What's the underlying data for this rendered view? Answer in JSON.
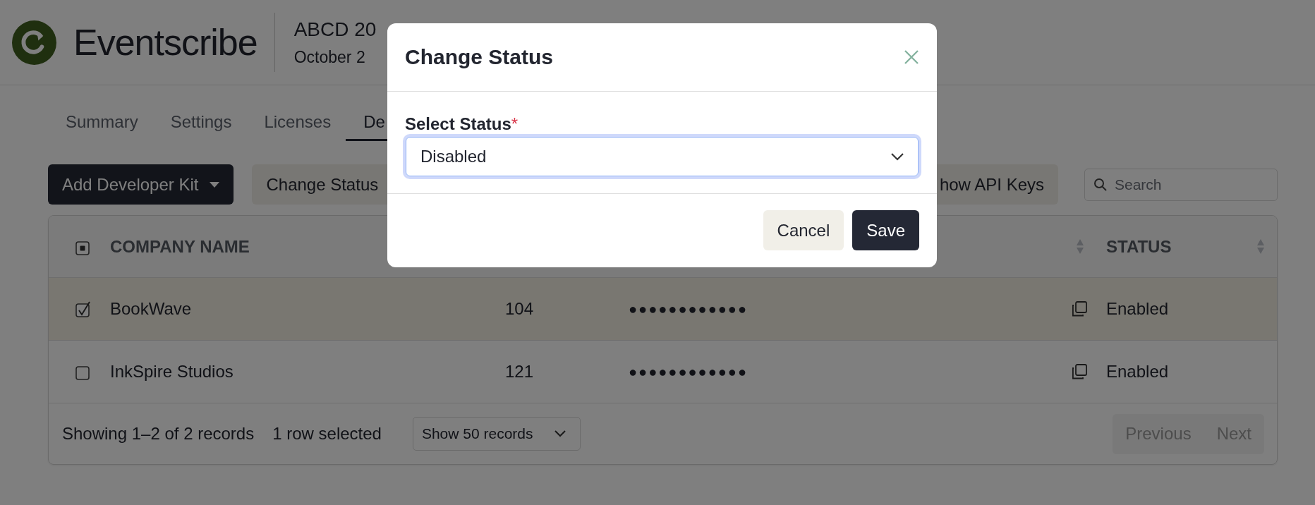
{
  "header": {
    "logo_text": "Eventscribe",
    "event_title": "ABCD 20",
    "event_date": "October 2"
  },
  "tabs": [
    {
      "label": "Summary",
      "selected": false
    },
    {
      "label": "Settings",
      "selected": false
    },
    {
      "label": "Licenses",
      "selected": false
    },
    {
      "label": "De",
      "selected": true
    }
  ],
  "toolbar": {
    "buttons": [
      {
        "label": "Add Developer Kit",
        "kind": "primary-dropdown"
      },
      {
        "label": "Change Status",
        "kind": "secondary"
      }
    ],
    "right_buttons": [
      {
        "label": "how API Keys",
        "kind": "secondary"
      }
    ],
    "search": {
      "placeholder": "Search"
    }
  },
  "table": {
    "select_all": {
      "indeterminate": true
    },
    "columns": [
      {
        "label": "COMPANY NAME",
        "sortable": false
      },
      {
        "sortable": true
      },
      {
        "label": "STATUS",
        "sortable": true
      }
    ],
    "rows": [
      {
        "selected": true,
        "company": "BookWave",
        "number": "104",
        "key": "●●●●●●●●●●●●",
        "status": "Enabled"
      },
      {
        "selected": false,
        "company": "InkSpire Studios",
        "number": "121",
        "key": "●●●●●●●●●●●●",
        "status": "Enabled"
      }
    ],
    "footer": {
      "summary": "Showing 1–2 of 2 records",
      "selection": "1 row selected",
      "page_size": "Show 50 records",
      "pager": [
        {
          "label": "Previous",
          "disabled": true
        },
        {
          "label": "Next",
          "disabled": true
        }
      ]
    }
  },
  "modal": {
    "title": "Change Status",
    "field": {
      "label": "Select Status",
      "required_mark": "*",
      "value": "Disabled"
    },
    "buttons": [
      {
        "label": "Cancel",
        "kind": "secondary"
      },
      {
        "label": "Save",
        "kind": "primary"
      }
    ]
  }
}
